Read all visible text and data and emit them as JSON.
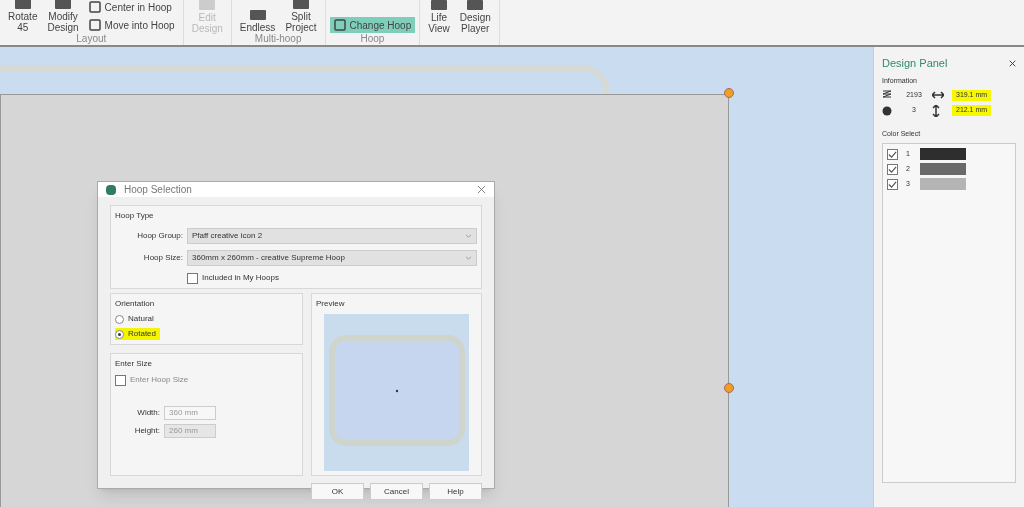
{
  "ribbon": {
    "groups": [
      {
        "label": "Layout",
        "buttons": [
          {
            "kind": "large",
            "label": "Rotate\n45",
            "disabled": false,
            "selected": false
          },
          {
            "kind": "large",
            "label": "Modify\nDesign",
            "disabled": false,
            "selected": false
          },
          {
            "kind": "small",
            "label": "Center in Hoop",
            "disabled": false,
            "selected": false
          },
          {
            "kind": "small",
            "label": "Move into Hoop",
            "disabled": false,
            "selected": false
          }
        ]
      },
      {
        "buttons": [
          {
            "kind": "large",
            "label": "Edit\nDesign",
            "disabled": true,
            "selected": false
          }
        ]
      },
      {
        "label": "Multi-hoop",
        "buttons": [
          {
            "kind": "large",
            "label": "Endless",
            "disabled": false,
            "selected": false
          },
          {
            "kind": "large",
            "label": "Split\nProject",
            "disabled": false,
            "selected": false
          }
        ]
      },
      {
        "label": "Hoop",
        "buttons": [
          {
            "kind": "small",
            "label": "Change Hoop",
            "disabled": false,
            "selected": true
          }
        ]
      },
      {
        "buttons": [
          {
            "kind": "large",
            "label": "Life\nView",
            "disabled": false,
            "selected": false
          },
          {
            "kind": "large",
            "label": "Design\nPlayer",
            "disabled": false,
            "selected": false
          }
        ]
      }
    ]
  },
  "dialog": {
    "title": "Hoop Selection",
    "hoop_type": {
      "title": "Hoop Type",
      "group_label": "Hoop Group:",
      "group_value": "Pfaff creative icon 2",
      "size_label": "Hoop Size:",
      "size_value": "360mm x 260mm - creative Supreme Hoop",
      "my_hoops": {
        "label": "Included in My Hoops",
        "checked": false
      }
    },
    "orientation": {
      "title": "Orientation",
      "options": [
        {
          "label": "Natural",
          "selected": false,
          "highlighted": false
        },
        {
          "label": "Rotated",
          "selected": true,
          "highlighted": true
        }
      ]
    },
    "enter_size": {
      "title": "Enter Size",
      "checkbox": {
        "label": "Enter Hoop Size",
        "checked": false
      },
      "width_label": "Width:",
      "width_value": "360 mm",
      "height_label": "Height:",
      "height_value": "260 mm"
    },
    "preview": {
      "title": "Preview"
    },
    "buttons": [
      "OK",
      "Cancel",
      "Help"
    ]
  },
  "design_panel": {
    "title": "Design Panel",
    "info_title": "Information",
    "stitches": "2193",
    "colors": "3",
    "width": {
      "value": "319.1 mm",
      "highlighted": true
    },
    "height": {
      "value": "212.1 mm",
      "highlighted": true
    },
    "color_select_title": "Color Select",
    "colors_list": [
      {
        "number": "1",
        "checked": true,
        "color": "#2e2e2e"
      },
      {
        "number": "2",
        "checked": true,
        "color": "#6a6a6a"
      },
      {
        "number": "3",
        "checked": true,
        "color": "#b4b4b4"
      }
    ]
  }
}
